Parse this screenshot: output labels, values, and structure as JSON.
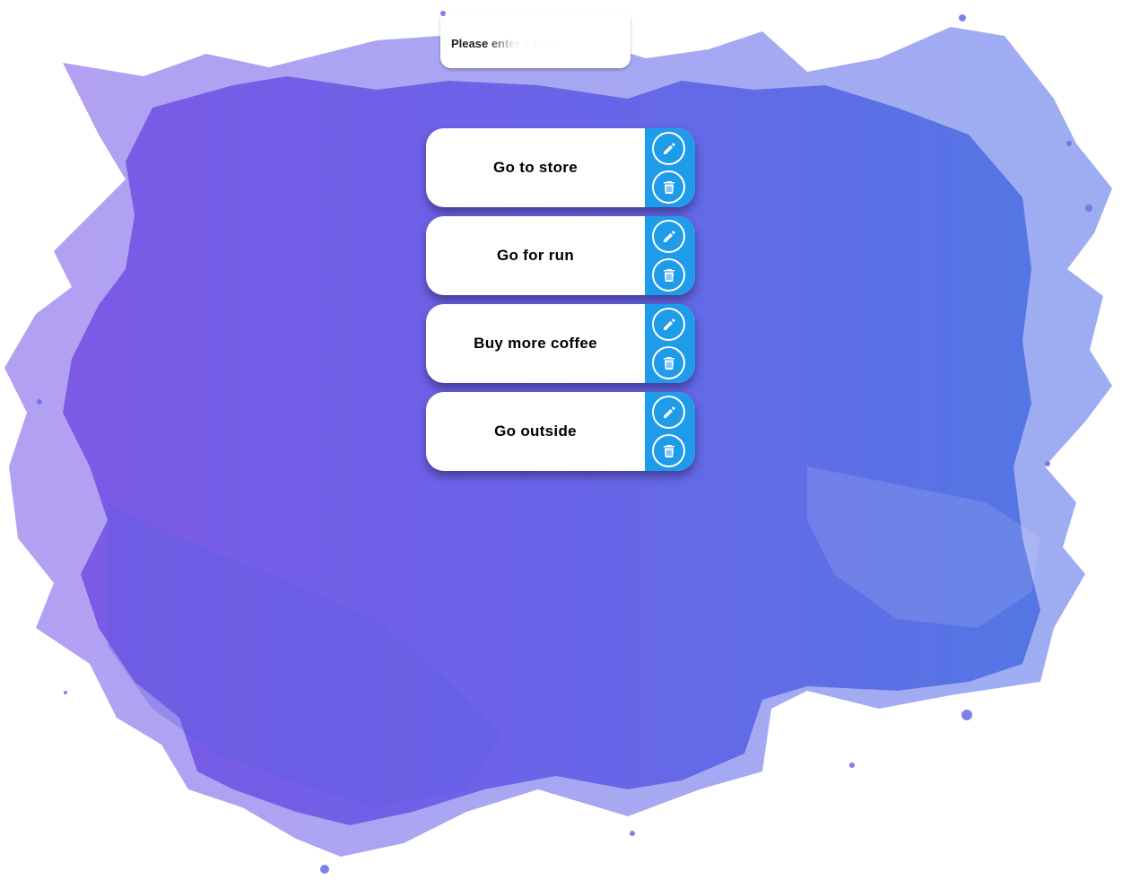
{
  "new_todo": {
    "placeholder": "Please enter a todo"
  },
  "todos": [
    {
      "text": "Go to store"
    },
    {
      "text": "Go for run"
    },
    {
      "text": "Buy more coffee"
    },
    {
      "text": "Go outside"
    }
  ],
  "icons": {
    "edit": "pencil-icon",
    "delete": "trash-icon"
  },
  "colors": {
    "action_panel": "#1e9be9",
    "splash_left": "#7b5ce8",
    "splash_right": "#5a6ee6",
    "card_background": "#ffffff"
  }
}
